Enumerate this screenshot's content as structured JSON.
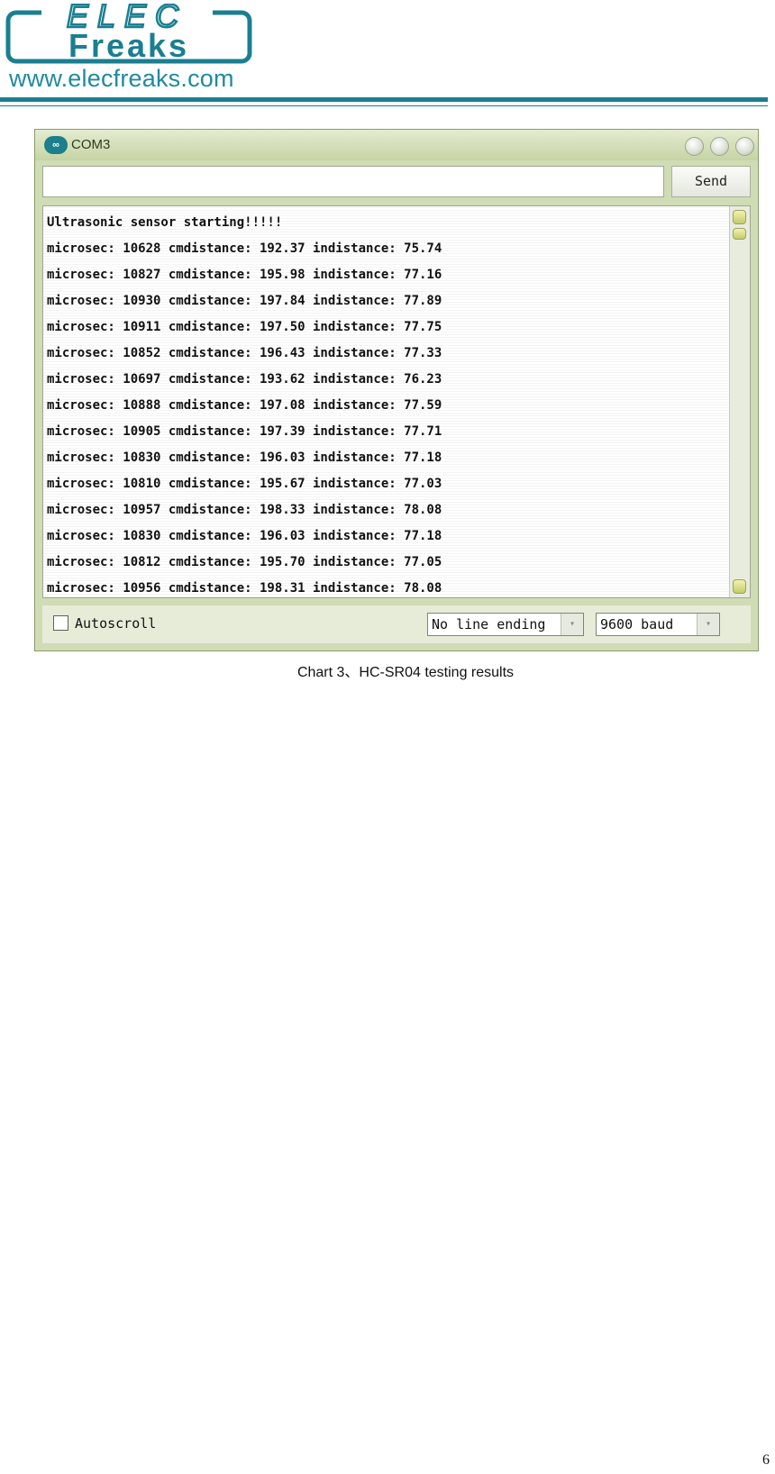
{
  "header": {
    "logo_top": "ELEC",
    "logo_bottom": "Freaks",
    "url": "www.elecfreaks.com",
    "brand_color": "#1a7f90"
  },
  "window": {
    "title": "COM3",
    "send_input_value": "",
    "send_label": "Send",
    "output_lines": [
      "Ultrasonic sensor starting!!!!!",
      "microsec: 10628 cmdistance: 192.37 indistance: 75.74",
      "microsec: 10827 cmdistance: 195.98 indistance: 77.16",
      "microsec: 10930 cmdistance: 197.84 indistance: 77.89",
      "microsec: 10911 cmdistance: 197.50 indistance: 77.75",
      "microsec: 10852 cmdistance: 196.43 indistance: 77.33",
      "microsec: 10697 cmdistance: 193.62 indistance: 76.23",
      "microsec: 10888 cmdistance: 197.08 indistance: 77.59",
      "microsec: 10905 cmdistance: 197.39 indistance: 77.71",
      "microsec: 10830 cmdistance: 196.03 indistance: 77.18",
      "microsec: 10810 cmdistance: 195.67 indistance: 77.03",
      "microsec: 10957 cmdistance: 198.33 indistance: 78.08",
      "microsec: 10830 cmdistance: 196.03 indistance: 77.18",
      "microsec: 10812 cmdistance: 195.70 indistance: 77.05",
      "microsec: 10956 cmdistance: 198.31 indistance: 78.08"
    ],
    "autoscroll_label": "Autoscroll",
    "autoscroll_checked": false,
    "line_ending": "No line ending",
    "baud": "9600 baud"
  },
  "caption": "Chart 3、HC-SR04 testing results",
  "page_number": "6"
}
